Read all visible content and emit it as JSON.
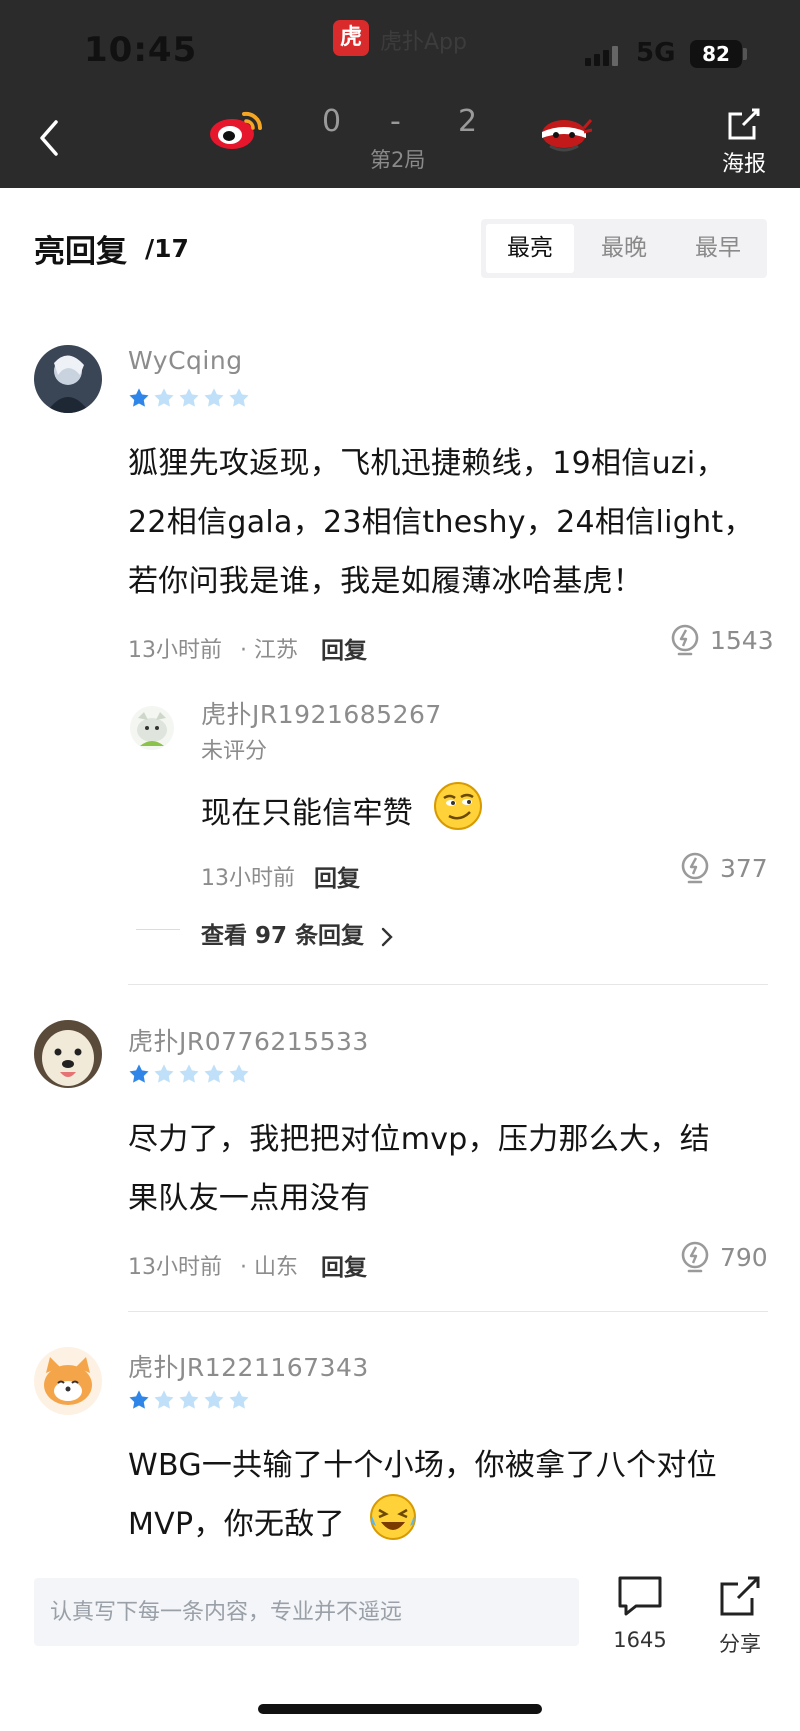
{
  "status_bar": {
    "time": "10:45",
    "app_badge": "虎",
    "app_name": "虎扑App",
    "network": "5G",
    "battery": "82"
  },
  "header": {
    "score_left": "0",
    "score_sep": "-",
    "score_right": "2",
    "round": "第2局",
    "poster_label": "海报"
  },
  "section": {
    "title": "亮回复",
    "count": "/17"
  },
  "sort_tabs": [
    "最亮",
    "最晚",
    "最早"
  ],
  "comments": [
    {
      "user": "WyCqing",
      "rating": 1,
      "lines": [
        "狐狸先攻返现，飞机迅捷赖线，19相信uzi，",
        "22相信gala，23相信theshy，24相信light，",
        "若你问我是谁，我是如履薄冰哈基虎！"
      ],
      "time": "13小时前",
      "location": "· 江苏",
      "reply_label": "回复",
      "likes": "1543",
      "reply": {
        "user": "虎扑JR1921685267",
        "rating_text": "未评分",
        "text": "现在只能信牢赞",
        "time": "13小时前",
        "reply_label": "回复",
        "likes": "377"
      },
      "view_more": "查看 97 条回复"
    },
    {
      "user": "虎扑JR0776215533",
      "rating": 1,
      "lines": [
        "尽力了，我把把对位mvp，压力那么大，结",
        "果队友一点用没有"
      ],
      "time": "13小时前",
      "location": "· 山东",
      "reply_label": "回复",
      "likes": "790"
    },
    {
      "user": "虎扑JR1221167343",
      "rating": 1,
      "lines": [
        "WBG一共输了十个小场，你被拿了八个对位",
        "MVP，你无敌了"
      ]
    }
  ],
  "bottom_bar": {
    "input_placeholder": "认真写下每一条内容，专业并不遥远",
    "comment_count": "1645",
    "share_label": "分享"
  },
  "colors": {
    "header_bg": "#2b2b2b",
    "star_filled": "#2f86e8",
    "star_empty": "#bfe0f8",
    "brand_red": "#d92b2b"
  }
}
